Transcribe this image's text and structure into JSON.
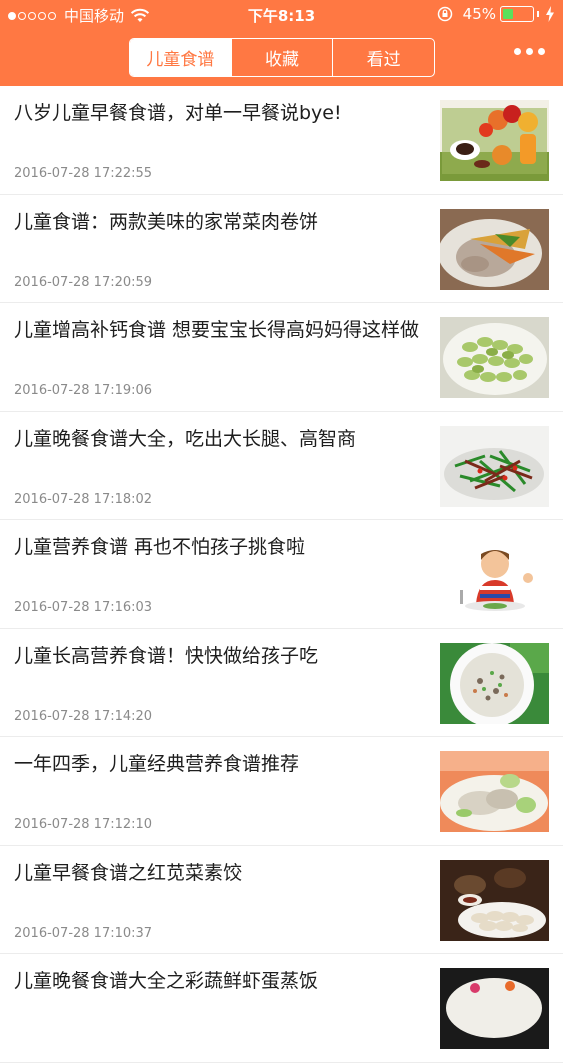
{
  "status_bar": {
    "carrier": "中国移动",
    "time": "下午8:13",
    "battery_percent": "45%",
    "battery_level": 0.45,
    "signal_dots_filled": 1,
    "signal_dots_total": 5
  },
  "tabs": [
    {
      "label": "儿童食谱",
      "active": true
    },
    {
      "label": "收藏",
      "active": false
    },
    {
      "label": "看过",
      "active": false
    }
  ],
  "colors": {
    "accent": "#ff7843"
  },
  "icons": [
    "wifi-icon",
    "lock-rotation-icon",
    "battery-icon",
    "charging-icon",
    "more-icon"
  ],
  "articles": [
    {
      "title": "八岁儿童早餐食谱，对单一早餐说bye!",
      "date": "2016-07-28 17:22:55",
      "thumb": "breakfast-fruit-image"
    },
    {
      "title": "儿童食谱：两款美味的家常菜肉卷饼",
      "date": "2016-07-28 17:20:59",
      "thumb": "meat-roll-image"
    },
    {
      "title": "儿童增高补钙食谱 想要宝宝长得高妈妈得这样做",
      "date": "2016-07-28 17:19:06",
      "thumb": "soybeans-image"
    },
    {
      "title": "儿童晚餐食谱大全，吃出大长腿、高智商",
      "date": "2016-07-28 17:18:02",
      "thumb": "stir-fry-image"
    },
    {
      "title": "儿童营养食谱 再也不怕孩子挑食啦",
      "date": "2016-07-28 17:16:03",
      "thumb": "child-eating-image"
    },
    {
      "title": "儿童长高营养食谱！快快做给孩子吃",
      "date": "2016-07-28 17:14:20",
      "thumb": "porridge-image"
    },
    {
      "title": "一年四季，儿童经典营养食谱推荐",
      "date": "2016-07-28 17:12:10",
      "thumb": "vegetable-dish-image"
    },
    {
      "title": "儿童早餐食谱之红苋菜素饺",
      "date": "2016-07-28 17:10:37",
      "thumb": "dumplings-image"
    },
    {
      "title": "儿童晚餐食谱大全之彩蔬鲜虾蛋蒸饭",
      "date": "",
      "thumb": "steamed-rice-image"
    }
  ]
}
